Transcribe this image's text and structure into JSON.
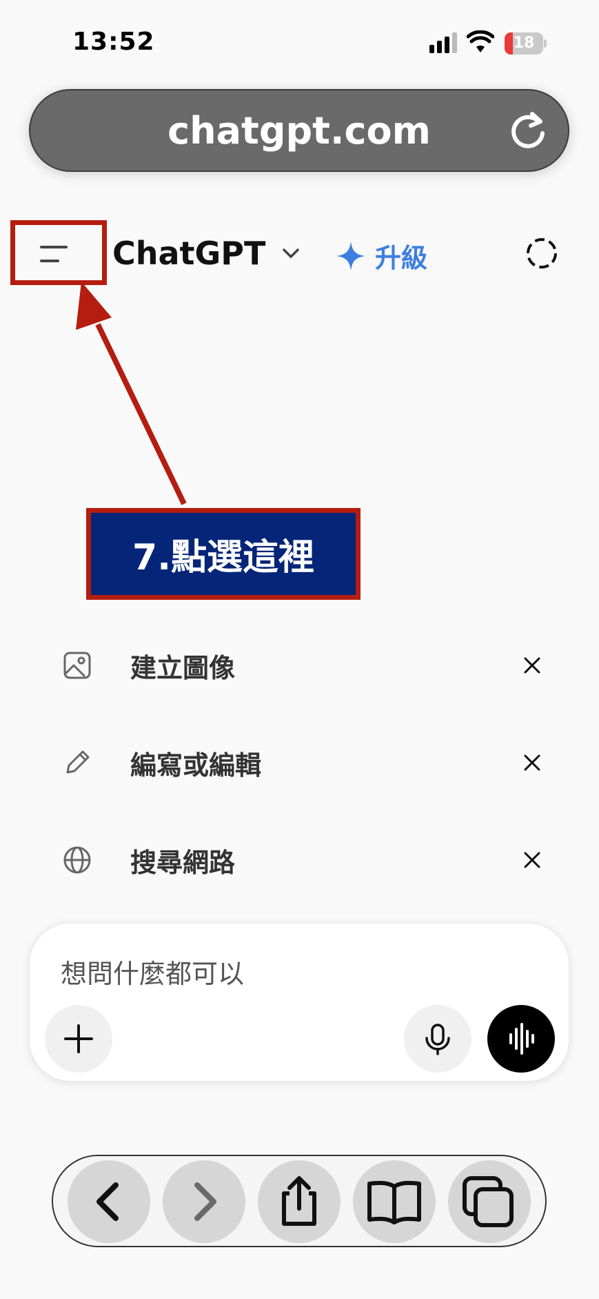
{
  "status_bar": {
    "time": "13:52",
    "battery_level": "18"
  },
  "browser": {
    "url": "chatgpt.com"
  },
  "header": {
    "title": "ChatGPT",
    "upgrade_label": "升級"
  },
  "annotation": {
    "label": "7.點選這裡",
    "box_color": "#b41d0f",
    "label_bg": "#042578"
  },
  "suggestions": [
    {
      "icon": "image-icon",
      "label": "建立圖像"
    },
    {
      "icon": "pencil-icon",
      "label": "編寫或編輯"
    },
    {
      "icon": "globe-icon",
      "label": "搜尋網路"
    }
  ],
  "composer": {
    "placeholder": "想問什麼都可以"
  },
  "colors": {
    "accent": "#3d7fe0"
  }
}
